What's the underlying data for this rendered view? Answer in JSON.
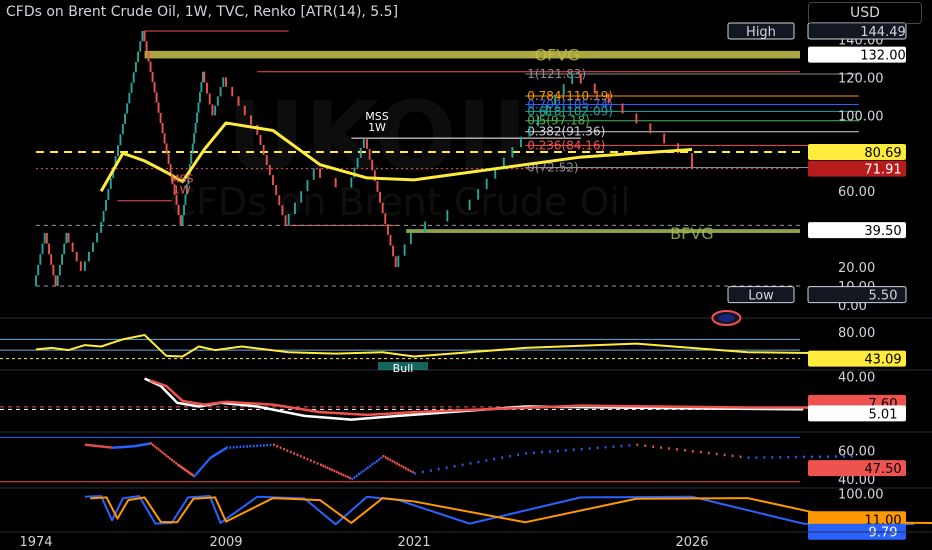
{
  "header": {
    "title": "CFDs on Brent Crude Oil, 1W, TVC, Renko [ATR(14), 5.5]",
    "currency_button": "USD"
  },
  "watermark": {
    "symbol": "UKOIL",
    "description": "CFDs on Brent Crude Oil"
  },
  "colors": {
    "background": "#000000",
    "bull": "#26a69a",
    "bear": "#ef5350",
    "ma": "#ffeb3b",
    "axis_text": "#d1d4dc",
    "grid_line": "#2a2e39"
  },
  "chart_data": {
    "type": "line",
    "panes": [
      {
        "name": "price",
        "price_axis_ticks": [
          "140.00",
          "120.00",
          "100.00",
          "80.00",
          "60.00",
          "40.00",
          "20.00",
          "10.00",
          "0.00"
        ],
        "y_range": [
          0,
          145
        ],
        "renko_path": [
          [
            1974,
            10
          ],
          [
            1976,
            38
          ],
          [
            1978,
            10
          ],
          [
            1980,
            38
          ],
          [
            1983,
            18
          ],
          [
            1986,
            38
          ],
          [
            1990,
            90
          ],
          [
            1994,
            144.5
          ],
          [
            2001,
            42
          ],
          [
            2005,
            123
          ],
          [
            2007,
            100
          ],
          [
            2009,
            120
          ],
          [
            2011,
            95
          ],
          [
            2013,
            42
          ],
          [
            2015,
            72
          ],
          [
            2017,
            62
          ],
          [
            2018,
            88
          ],
          [
            2020,
            20
          ],
          [
            2022,
            50
          ],
          [
            2024,
            122
          ],
          [
            2026,
            80
          ],
          [
            2027,
            72
          ]
        ],
        "moving_average": [
          [
            1986,
            60
          ],
          [
            1990,
            80
          ],
          [
            1994,
            76
          ],
          [
            1998,
            70
          ],
          [
            2001,
            65
          ],
          [
            2005,
            82
          ],
          [
            2009,
            96
          ],
          [
            2012,
            92
          ],
          [
            2015,
            74
          ],
          [
            2018,
            67
          ],
          [
            2021,
            66
          ],
          [
            2024,
            78
          ],
          [
            2026,
            82
          ]
        ],
        "high": 144.49,
        "low": 5.5,
        "current_price": "80.69",
        "price_labels": [
          {
            "text": "High",
            "value": "144.49",
            "kind": "high"
          },
          {
            "text": "",
            "value": "132.00",
            "kind": "level"
          },
          {
            "text": "",
            "value": "80.69",
            "kind": "current"
          },
          {
            "text": "",
            "value": "71.91",
            "kind": "fib_low"
          },
          {
            "text": "",
            "value": "39.50",
            "kind": "level"
          },
          {
            "text": "Low",
            "value": "5.50",
            "kind": "low"
          }
        ],
        "fibonacci": {
          "from_year": 2023,
          "to_year": 2029,
          "levels": [
            {
              "label": "1(121.83)",
              "value": 121.83,
              "color": "#8a8d96"
            },
            {
              "label": "0.784(110.19)",
              "value": 110.19,
              "color": "#ff9800"
            },
            {
              "label": "0.702(105.74)",
              "value": 105.74,
              "color": "#2962ff"
            },
            {
              "label": "0.618(102.09)",
              "value": 102.09,
              "color": "#26a69a"
            },
            {
              "label": "0.5(97.18)",
              "value": 97.18,
              "color": "#4caf50"
            },
            {
              "label": "0.382(91.36)",
              "value": 91.36,
              "color": "#d1d4dc"
            },
            {
              "label": "0.236(84.16)",
              "value": 84.16,
              "color": "#ef5350"
            },
            {
              "label": "0(72.52)",
              "value": 72.52,
              "color": "#8a8d96"
            }
          ]
        },
        "zones": [
          {
            "label": "OFVG",
            "from_value": 130,
            "to_value": 134,
            "from_year": 1994,
            "to_year": 2055,
            "color": "#c9c34a"
          },
          {
            "label": "BFVG",
            "from_value": 38,
            "to_value": 40,
            "from_year": 2020.5,
            "to_year": 2055,
            "color": "#a5c25a"
          }
        ],
        "annotations": [
          {
            "text": "MSS",
            "sub": "1W",
            "year": 2018,
            "value": 88,
            "color": "#ffffff"
          },
          {
            "text": "MSS",
            "sub": "1W",
            "year": 1999,
            "value": 55,
            "color": "#ef5350"
          }
        ],
        "reference_lines": [
          {
            "value": 144.49,
            "from_year": 1994,
            "to_year": 2013,
            "color": "#ef5350"
          },
          {
            "value": 123,
            "from_year": 2011,
            "to_year": 2040,
            "color": "#ef5350"
          },
          {
            "value": 55,
            "from_year": 1989,
            "to_year": 1999,
            "color": "#ef5350"
          },
          {
            "value": 42,
            "from_year": 2013,
            "to_year": 2020,
            "color": "#ef5350"
          },
          {
            "value": 88,
            "from_year": 2017,
            "to_year": 2024,
            "color": "#ffffff"
          },
          {
            "value": 42,
            "from_year": 1974,
            "to_year": 2055,
            "color": "#9e9e9e",
            "dashed": true
          },
          {
            "value": 10,
            "from_year": 1974,
            "to_year": 2055,
            "color": "#9e9e9e",
            "dashed": true
          },
          {
            "value": 80.69,
            "from_year": 1974,
            "to_year": 2055,
            "color": "#ffeb3b",
            "dashed": true,
            "thick": true
          },
          {
            "value": 71.91,
            "from_year": 1974,
            "to_year": 2055,
            "color": "#ef5350",
            "dotted": true
          }
        ]
      },
      {
        "name": "rsi",
        "ticks": [
          "80.00"
        ],
        "y_range": [
          30,
          90
        ],
        "value": "43.09",
        "label": "Bull",
        "series": [
          [
            1974,
            56
          ],
          [
            1977,
            58
          ],
          [
            1980,
            55
          ],
          [
            1983,
            62
          ],
          [
            1986,
            60
          ],
          [
            1990,
            70
          ],
          [
            1994,
            76
          ],
          [
            1998,
            47
          ],
          [
            2001,
            46
          ],
          [
            2004,
            60
          ],
          [
            2007,
            55
          ],
          [
            2010,
            60
          ],
          [
            2013,
            52
          ],
          [
            2016,
            50
          ],
          [
            2019,
            52
          ],
          [
            2021,
            46
          ],
          [
            2023,
            58
          ],
          [
            2025,
            64
          ],
          [
            2027,
            52
          ],
          [
            2029,
            50
          ]
        ],
        "levels": [
          {
            "value": 70,
            "color": "#6fa8dc"
          },
          {
            "value": 55,
            "color": "#6fa8dc"
          },
          {
            "value": 43.09,
            "color": "#ffeb3b",
            "dashed": true
          }
        ]
      },
      {
        "name": "macd",
        "ticks": [
          "40.00",
          "0"
        ],
        "y_range": [
          -15,
          45
        ],
        "values": [
          "7.60",
          "5.01"
        ],
        "series": [
          {
            "name": "",
            "color": "#ffffff",
            "values": [
              [
                1994,
                38
              ],
              [
                1997,
                30
              ],
              [
                2000,
                12
              ],
              [
                2004,
                8
              ],
              [
                2008,
                12
              ],
              [
                2011,
                8
              ],
              [
                2014,
                -2
              ],
              [
                2017,
                -6
              ],
              [
                2020,
                -2
              ],
              [
                2023,
                8
              ],
              [
                2026,
                6
              ],
              [
                2028,
                5
              ]
            ]
          },
          {
            "name": "",
            "color": "#ef5350",
            "values": [
              [
                1995,
                36
              ],
              [
                1998,
                30
              ],
              [
                2001,
                14
              ],
              [
                2005,
                10
              ],
              [
                2009,
                13
              ],
              [
                2012,
                10
              ],
              [
                2015,
                2
              ],
              [
                2018,
                -1
              ],
              [
                2021,
                2
              ],
              [
                2024,
                9
              ],
              [
                2027,
                7
              ],
              [
                2029,
                7
              ]
            ]
          }
        ],
        "levels": [
          {
            "value": 7.6,
            "color": "#ef5350",
            "dashed": true
          },
          {
            "value": 5.01,
            "color": "#ffffff",
            "dashed": true
          }
        ]
      },
      {
        "name": "oscillator",
        "ticks": [
          "60.00",
          "40.00"
        ],
        "y_range": [
          35,
          70
        ],
        "value": "47.50",
        "series": [
          [
            1983,
            64
          ],
          [
            1988,
            62
          ],
          [
            1992,
            63
          ],
          [
            1995,
            65
          ],
          [
            2000,
            50
          ],
          [
            2003,
            42
          ],
          [
            2006,
            55
          ],
          [
            2009,
            62
          ],
          [
            2012,
            64
          ],
          [
            2015,
            50
          ],
          [
            2017,
            40
          ],
          [
            2019,
            56
          ],
          [
            2021,
            44
          ],
          [
            2023,
            58
          ],
          [
            2025,
            64
          ],
          [
            2027,
            55
          ],
          [
            2029,
            56
          ]
        ],
        "levels": [
          {
            "value": 69,
            "color": "#2962ff"
          },
          {
            "value": 38,
            "color": "#ef5350"
          }
        ]
      },
      {
        "name": "stochastic",
        "ticks": [
          "100.00"
        ],
        "y_range": [
          0,
          110
        ],
        "values": [
          "11.00",
          "9.79"
        ],
        "series": [
          {
            "name": "",
            "color": "#2962ff",
            "values": [
              [
                1983,
                90
              ],
              [
                1986,
                92
              ],
              [
                1988,
                20
              ],
              [
                1990,
                85
              ],
              [
                1993,
                92
              ],
              [
                1996,
                10
              ],
              [
                1999,
                12
              ],
              [
                2002,
                88
              ],
              [
                2006,
                92
              ],
              [
                2008,
                12
              ],
              [
                2011,
                90
              ],
              [
                2014,
                85
              ],
              [
                2016,
                8
              ],
              [
                2018,
                90
              ],
              [
                2020,
                80
              ],
              [
                2022,
                10
              ],
              [
                2024,
                88
              ],
              [
                2026,
                90
              ],
              [
                2028,
                10
              ],
              [
                2030,
                9
              ]
            ]
          },
          {
            "name": "",
            "color": "#ff9800",
            "values": [
              [
                1984,
                85
              ],
              [
                1987,
                88
              ],
              [
                1989,
                25
              ],
              [
                1991,
                80
              ],
              [
                1994,
                88
              ],
              [
                1997,
                15
              ],
              [
                2000,
                14
              ],
              [
                2003,
                84
              ],
              [
                2007,
                88
              ],
              [
                2009,
                16
              ],
              [
                2012,
                86
              ],
              [
                2015,
                80
              ],
              [
                2017,
                12
              ],
              [
                2019,
                86
              ],
              [
                2021,
                76
              ],
              [
                2023,
                14
              ],
              [
                2025,
                84
              ],
              [
                2027,
                86
              ],
              [
                2029,
                14
              ],
              [
                2031,
                11
              ]
            ]
          }
        ]
      }
    ],
    "x_axis": {
      "ticks": [
        "1974",
        "2009",
        "2021",
        "2026"
      ],
      "tick_years": [
        1974,
        2009,
        2021,
        2026
      ]
    }
  }
}
